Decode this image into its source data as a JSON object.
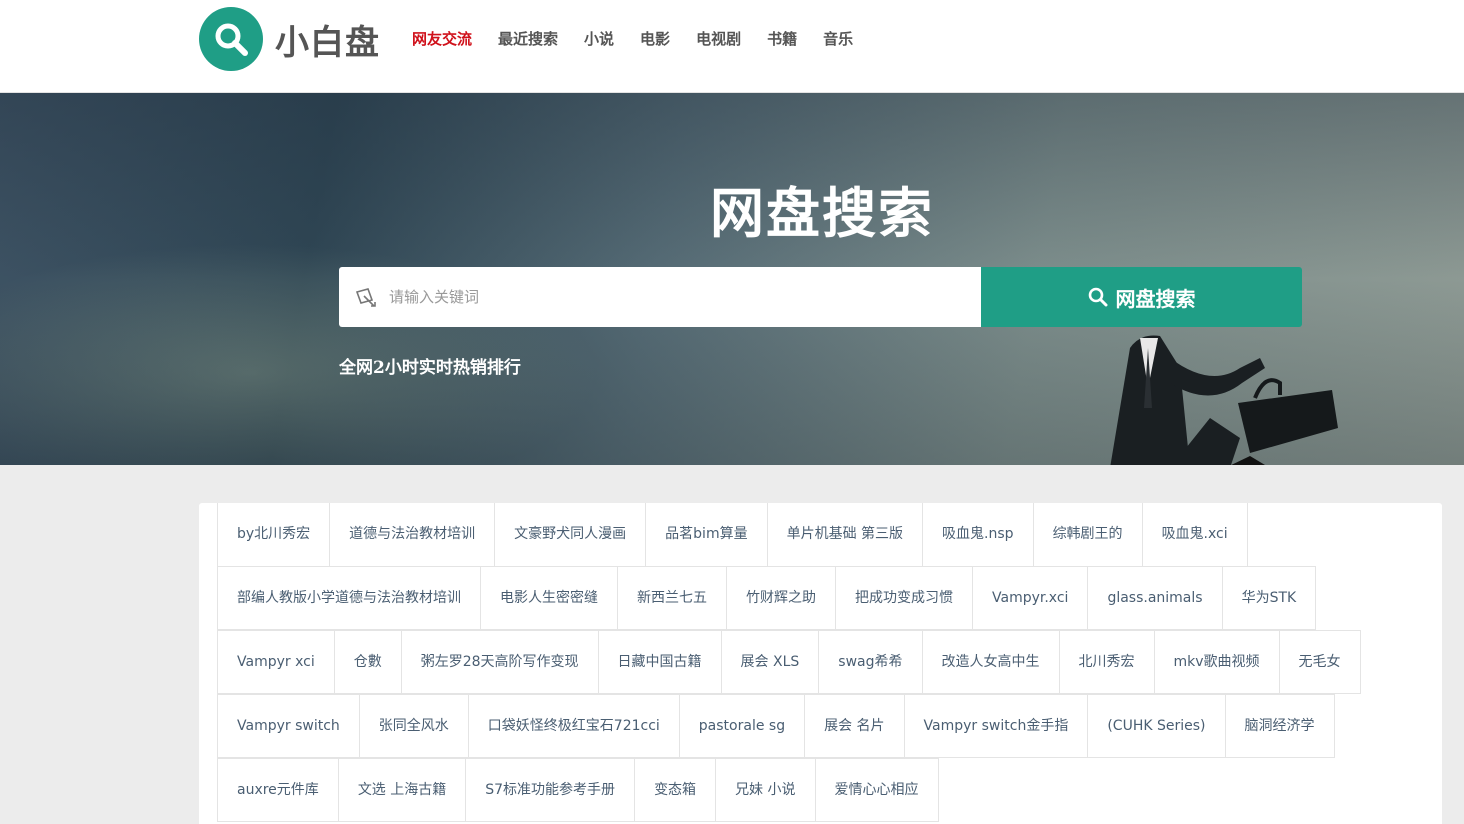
{
  "site": {
    "name": "小白盘",
    "brand_color": "#1f9e86"
  },
  "nav": [
    {
      "label": "网友交流",
      "active": true
    },
    {
      "label": "最近搜索"
    },
    {
      "label": "小说"
    },
    {
      "label": "电影"
    },
    {
      "label": "电视剧"
    },
    {
      "label": "书籍"
    },
    {
      "label": "音乐"
    }
  ],
  "hero": {
    "title": "网盘搜索",
    "search_placeholder": "请输入关键词",
    "search_button": "网盘搜索",
    "hot_title": "全网2小时实时热销排行"
  },
  "tags": [
    [
      "by北川秀宏",
      "道德与法治教材培训",
      "文豪野犬同人漫画",
      "品茗bim算量",
      "单片机基础 第三版",
      "吸血鬼.nsp",
      "综韩剧王的",
      "吸血鬼.xci"
    ],
    [
      "部编人教版小学道德与法治教材培训",
      "电影人生密密缝",
      "新西兰七五",
      "竹财辉之助",
      "把成功变成习惯",
      "Vampyr.xci",
      "glass.animals",
      "华为STK"
    ],
    [
      "Vampyr xci",
      "仓數",
      "粥左罗28天高阶写作变现",
      "日藏中国古籍",
      "展会 XLS",
      "swag希希",
      "改造人女高中生",
      "北川秀宏",
      "mkv歌曲视频",
      "无毛女"
    ],
    [
      "Vampyr switch",
      "张同全风水",
      "口袋妖怪终极红宝石721cci",
      "pastorale sg",
      "展会 名片",
      "Vampyr switch金手指",
      "(CUHK Series)",
      "脑洞经济学"
    ],
    [
      "auxre元件库",
      "文选 上海古籍",
      "S7标准功能参考手册",
      "变态箱",
      "兄妹 小说",
      "爱情心心相应"
    ]
  ]
}
